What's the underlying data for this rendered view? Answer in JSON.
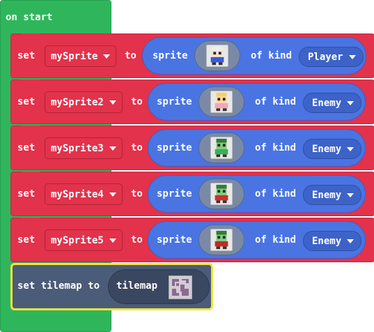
{
  "on_start": "on start",
  "blocks": [
    {
      "set": "set",
      "var": "mySprite",
      "to": "to",
      "sprite": "sprite",
      "of_kind": "of kind",
      "kind": "Player",
      "icon": "player-sprite-icon",
      "color": "#3a5ad8"
    },
    {
      "set": "set",
      "var": "mySprite2",
      "to": "to",
      "sprite": "sprite",
      "of_kind": "of kind",
      "kind": "Enemy",
      "icon": "princess-sprite-icon",
      "color": "#f2a6b8"
    },
    {
      "set": "set",
      "var": "mySprite3",
      "to": "to",
      "sprite": "sprite",
      "of_kind": "of kind",
      "kind": "Enemy",
      "icon": "zombie-sprite-icon",
      "color": "#3cae5a"
    },
    {
      "set": "set",
      "var": "mySprite4",
      "to": "to",
      "sprite": "sprite",
      "of_kind": "of kind",
      "kind": "Enemy",
      "icon": "zombie-red-sprite-icon",
      "color": "#cc3030"
    },
    {
      "set": "set",
      "var": "mySprite5",
      "to": "to",
      "sprite": "sprite",
      "of_kind": "of kind",
      "kind": "Enemy",
      "icon": "zombie-mixed-sprite-icon",
      "color": "#c02a2a"
    }
  ],
  "tilemap": {
    "label": "set tilemap to",
    "value": "tilemap",
    "icon": "tilemap-thumbnail-icon"
  }
}
